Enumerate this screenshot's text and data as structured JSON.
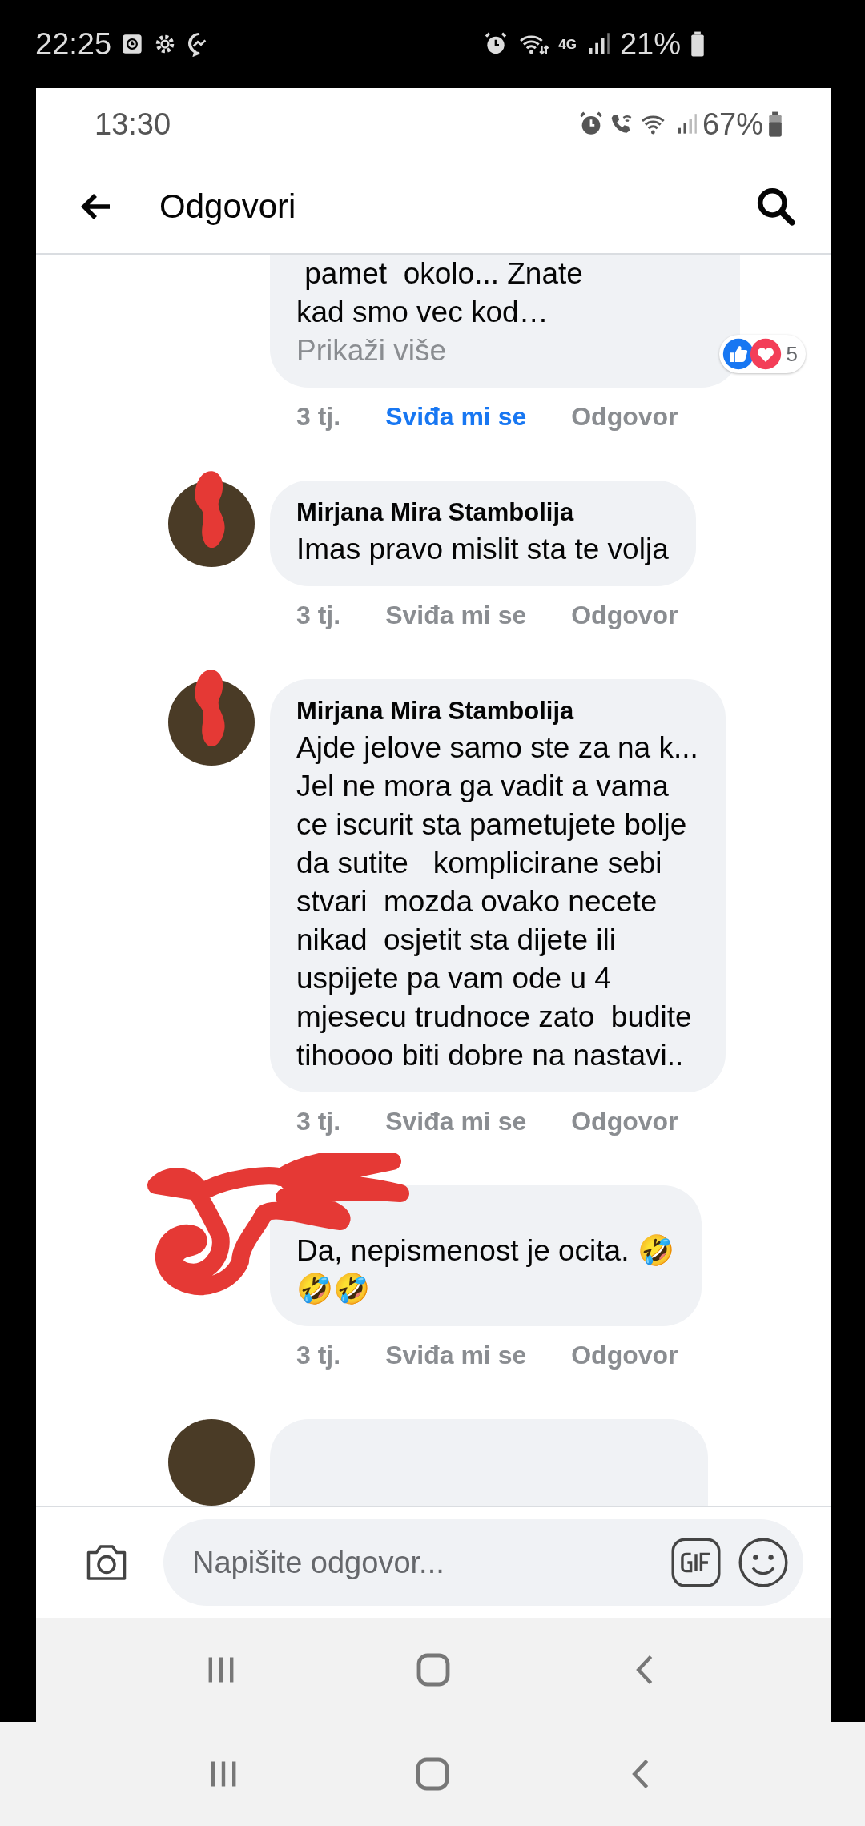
{
  "outer_status_bar": {
    "time": "22:25",
    "network": "4G",
    "battery": "21%"
  },
  "inner_status_bar": {
    "time": "13:30",
    "battery": "67%"
  },
  "header": {
    "title": "Odgovori"
  },
  "comments": [
    {
      "text": " pamet  okolo... Znate\nkad smo vec kod…",
      "see_more": "Prikaži više",
      "reaction_count": "5",
      "time": "3 tj.",
      "like": "Sviđa mi se",
      "liked": true,
      "reply": "Odgovor"
    },
    {
      "avatar": {
        "redacted": true
      },
      "author": "Mirjana Mira Stambolija",
      "text": "Imas pravo mislit sta te volja",
      "time": "3 tj.",
      "like": "Sviđa mi se",
      "liked": false,
      "reply": "Odgovor"
    },
    {
      "avatar": {
        "redacted": true
      },
      "author": "Mirjana Mira Stambolija",
      "text": "Ajde jelove samo ste za na k...\nJel ne mora ga vadit a vama\nce iscurit sta pametujete bolje\nda sutite   komplicirane sebi\nstvari  mozda ovako necete\nnikad  osjetit sta dijete ili\nuspijete pa vam ode u 4\nmjesecu trudnoce zato  budite\ntihoooo biti dobre na nastavi..",
      "time": "3 tj.",
      "like": "Sviđa mi se",
      "liked": false,
      "reply": "Odgovor"
    },
    {
      "author_redacted": true,
      "text": "Da, nepismenost je ocita. 🤣\n🤣🤣",
      "time": "3 tj.",
      "like": "Sviđa mi se",
      "liked": false,
      "reply": "Odgovor"
    },
    {
      "avatar": {
        "redacted": false
      }
    }
  ],
  "composer": {
    "placeholder": "Napišite odgovor..."
  }
}
